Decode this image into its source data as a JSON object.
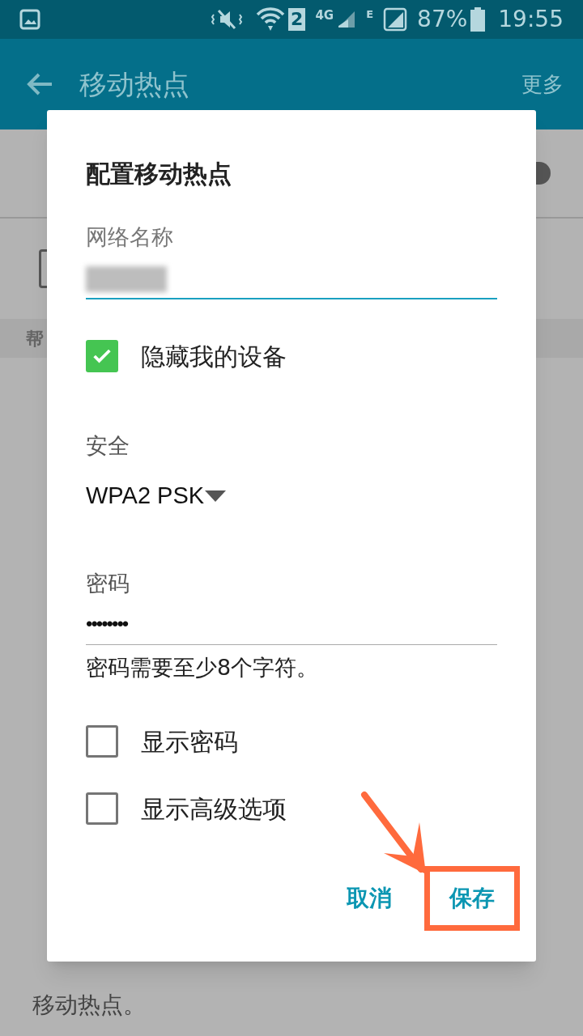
{
  "status_bar": {
    "sim_slot": "2",
    "network_type": "4G",
    "data_type": "E",
    "battery": "87%",
    "time": "19:55"
  },
  "app_bar": {
    "title": "移动热点",
    "more": "更多"
  },
  "background": {
    "switch_on": true,
    "section_header": "帮",
    "footer": "移动热点。"
  },
  "dialog": {
    "title": "配置移动热点",
    "network_name_label": "网络名称",
    "hide_device": {
      "label": "隐藏我的设备",
      "checked": true
    },
    "security_label": "安全",
    "security_value": "WPA2 PSK",
    "password_label": "密码",
    "password_value": "••••••••",
    "password_hint": "密码需要至少8个字符。",
    "options": [
      {
        "label": "显示密码",
        "checked": false
      },
      {
        "label": "显示高级选项",
        "checked": false
      }
    ],
    "buttons": [
      {
        "label": "取消",
        "highlighted": false
      },
      {
        "label": "保存",
        "highlighted": true
      }
    ]
  }
}
